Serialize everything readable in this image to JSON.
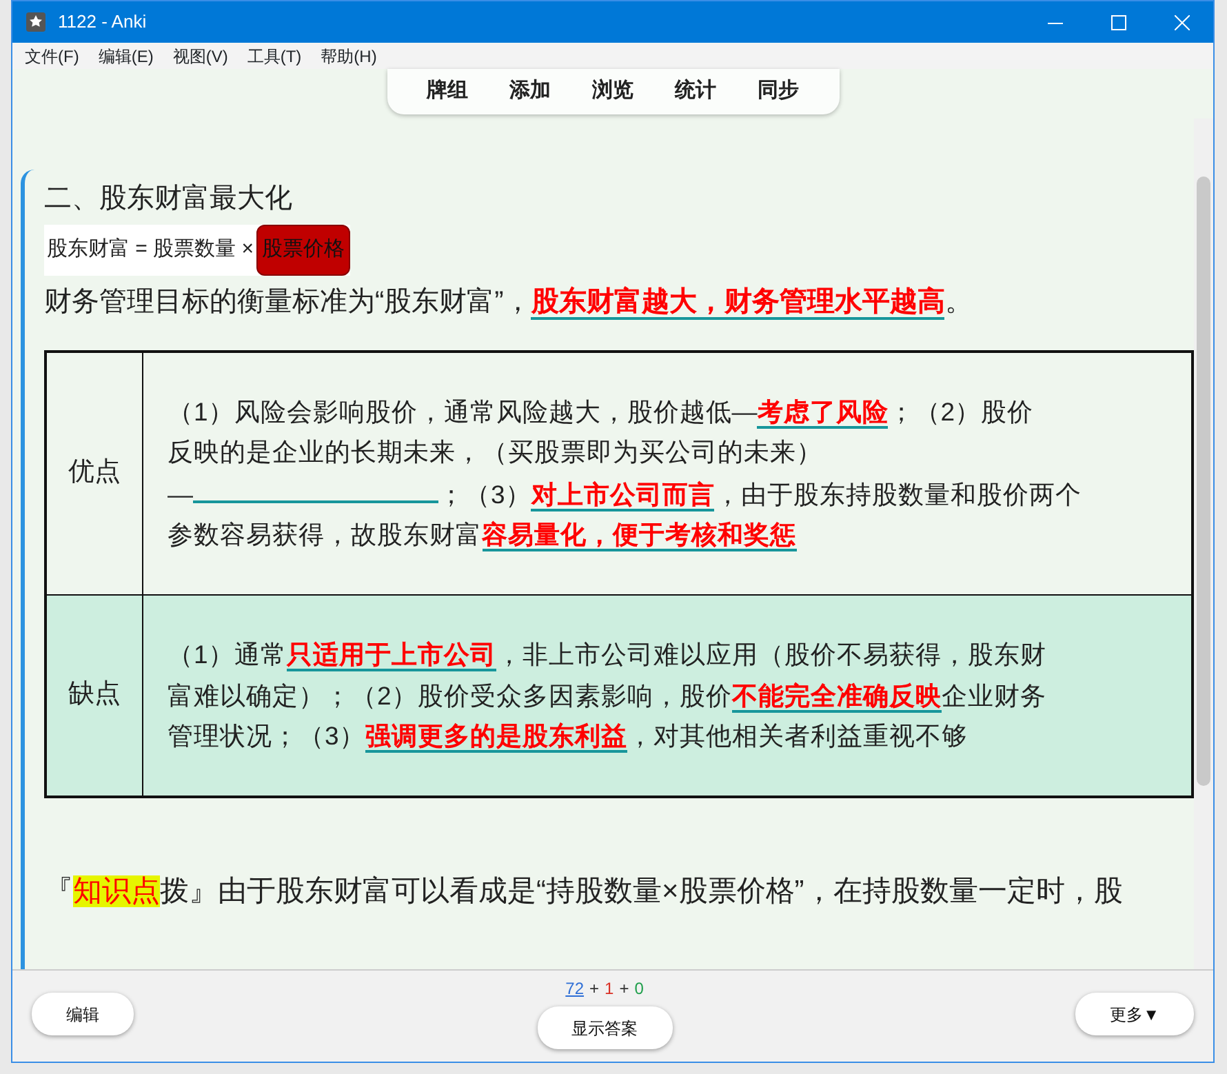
{
  "window": {
    "title": "1122 - Anki"
  },
  "menu": [
    "文件(F)",
    "编辑(E)",
    "视图(V)",
    "工具(T)",
    "帮助(H)"
  ],
  "toolbar": [
    "牌组",
    "添加",
    "浏览",
    "统计",
    "同步"
  ],
  "card": {
    "heading": "二、股东财富最大化",
    "formula": {
      "text": "股东财富 = 股票数量 ×",
      "tag": "股票价格"
    },
    "statement": "财务管理目标的衡量标准为“股东财富”，**股东财富越大，财务管理水平越高**。",
    "table": [
      {
        "label": "优点",
        "lines": [
          [
            {
              "kind": "text",
              "text": "（1）风险会影响股价，通常风险越大，股价越低—**考虑了风险**；（2）股价"
            }
          ],
          [
            {
              "kind": "text",
              "text": "反映的是企业的长期未来，（买股票即为买公司的未来）"
            }
          ],
          [
            {
              "kind": "text",
              "text": "—"
            },
            {
              "kind": "blank"
            },
            {
              "kind": "text",
              "text": "；（3）**对上市公司而言**，由于股东持股数量和股价两个"
            }
          ],
          [
            {
              "kind": "text",
              "text": "参数容易获得，故股东财富**容易量化，便于考核和奖惩**"
            }
          ]
        ]
      },
      {
        "label": "缺点",
        "lines": [
          [
            {
              "kind": "text",
              "text": "（1）通常**只适用于上市公司**，非上市公司难以应用（股价不易获得，股东财"
            }
          ],
          [
            {
              "kind": "text",
              "text": "富难以确定）；（2）股价受众多因素影响，股价**不能完全准确反映**企业财务"
            }
          ],
          [
            {
              "kind": "text",
              "text": "管理状况；（3）**强调更多的是股东利益**，对其他相关者利益重视不够"
            }
          ]
        ]
      }
    ],
    "tip": {
      "before": "『",
      "highlight": "知识点",
      "after": "拨』由于股东财富可以看成是“持股数量×股票价格”，在持股数量一定时，股"
    }
  },
  "counts": [
    {
      "text": "72",
      "kind": "link",
      "color": "#2f6fd6"
    },
    {
      "text": "+",
      "kind": "sep",
      "color": "#333333"
    },
    {
      "text": "1",
      "kind": "num",
      "color": "#d93025"
    },
    {
      "text": "+",
      "kind": "sep",
      "color": "#333333"
    },
    {
      "text": "0",
      "kind": "num",
      "color": "#1e9e4a"
    }
  ],
  "buttons": {
    "edit": "编辑",
    "show_answer": "显示答案",
    "more": "更多▼"
  }
}
